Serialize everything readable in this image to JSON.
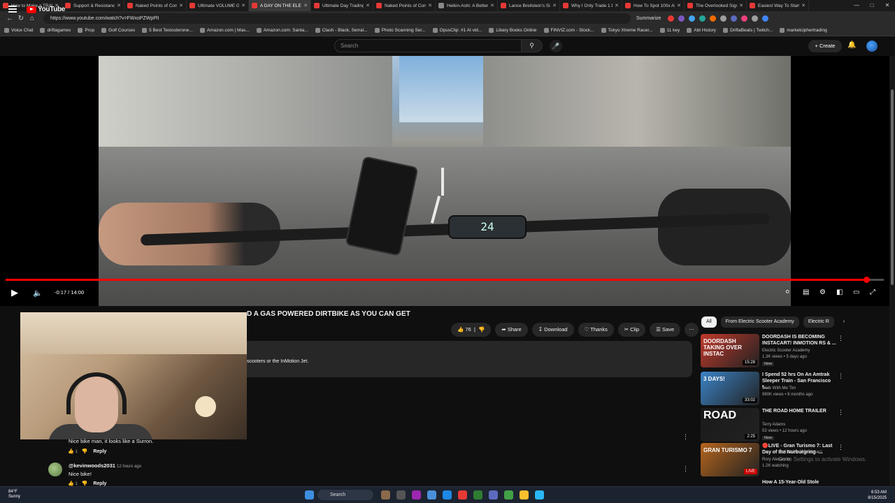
{
  "browser": {
    "tabs": [
      {
        "label": "How to Make a TRAD",
        "color": "#e53935"
      },
      {
        "label": "Support & Resistanc",
        "color": "#e53935"
      },
      {
        "label": "Naked Points of Cont",
        "color": "#e53935"
      },
      {
        "label": "Ultimate VOLUME Gu",
        "color": "#e53935"
      },
      {
        "label": "A DAY ON THE ELECT",
        "color": "#e53935",
        "active": true
      },
      {
        "label": "Ultimate Day Trading",
        "color": "#e53935"
      },
      {
        "label": "Naked Points of Cont",
        "color": "#e53935"
      },
      {
        "label": "Heikin-Ashi: A Better",
        "color": "#888888"
      },
      {
        "label": "Lance Breitstein's Sin",
        "color": "#e53935"
      },
      {
        "label": "Why I Only Trade 1 D",
        "color": "#e53935"
      },
      {
        "label": "How To Spot 100x Alt",
        "color": "#e53935"
      },
      {
        "label": "The Overlooked Sign",
        "color": "#e53935"
      },
      {
        "label": "Easiest Way To Start",
        "color": "#e53935"
      }
    ],
    "url": "https://www.youtube.com/watch?v=FWxoPZWpPlI",
    "summarize_label": "Summarize",
    "bookmarks": [
      "Voice Chat",
      "driftagames",
      "Prop",
      "Golf Courses",
      "5 Best Testosterone...",
      "Amazon.com | Mas...",
      "Amazon.com: Santa...",
      "Clash - Black, Serrat...",
      "Photo Scanning Ser...",
      "OpusClip: #1 AI vid...",
      "Libary Books Online",
      "FINVIZ.com - Stock...",
      "Tokyo Xtreme Racer...",
      "11 key",
      "Abt History",
      "DriftaBeats | Twitch...",
      "marketciphertrading"
    ]
  },
  "youtube": {
    "logo_text": "YouTube",
    "search_placeholder": "Search",
    "create_label": "+ Create"
  },
  "player": {
    "speedometer": "24",
    "timecode": "-0:17 / 14:00",
    "progress_fraction": 0.98
  },
  "video": {
    "title_visible": "D A GAS POWERED DIRTBIKE AS YOU CAN GET",
    "likes": "76",
    "share_label": "Share",
    "download_label": "Download",
    "thanks_label": "Thanks",
    "clip_label": "Clip",
    "save_label": "Save",
    "description_visible": "scooters or the InMotion Jet."
  },
  "comments": [
    {
      "author": "",
      "text": "Nice bike man, it looks like a Surron.",
      "likes": "1",
      "reply_label": "Reply"
    },
    {
      "author": "@kevinwoods2031",
      "time": "12 hours ago",
      "text": "Nice bike!",
      "likes": "1",
      "reply_label": "Reply"
    }
  ],
  "chips": [
    "All",
    "From Electric Scooter Academy",
    "Electric R"
  ],
  "recommendations": [
    {
      "title": "DOORDASH IS BECOMING INSTACART! INMOTION RS & ...",
      "channel": "Electric Scooter Academy",
      "views": "1.3K views • 5 days ago",
      "badge": "New",
      "duration": "15:28",
      "thumb_color": "#c0392b"
    },
    {
      "title": "I Spend 52 hrs On An Amtrak Sleeper Train - San Francisco t...",
      "channel": "Walk With Me Tim",
      "views": "980K views • 8 months ago",
      "badge": "",
      "duration": "33:02",
      "thumb_color": "#3b83c6"
    },
    {
      "title": "THE ROAD HOME TRAILER",
      "channel": "Terry Adams",
      "views": "53 views • 12 hours ago",
      "badge": "New",
      "duration": "2:25",
      "thumb_color": "#1a1a1a"
    },
    {
      "title": "🔴LIVE - Gran Turismo 7: Last Day of the Nurburgring -...",
      "channel": "Rory Alexander",
      "views": "1.2K watching",
      "badge": "",
      "duration": "LIVE",
      "thumb_color": "#b5651d"
    },
    {
      "title": "How A 15-Year-Old Stole",
      "channel": "",
      "views": "",
      "badge": "",
      "duration": "",
      "thumb_color": "#444444"
    }
  ],
  "thumb_texts": [
    "DOORDASH TAKING OVER INSTAC",
    "3 DAYS!",
    "ROAD",
    "GRAN TURISMO 7"
  ],
  "watermark": {
    "line1": "Activate Windows",
    "line2": "Go to Settings to activate Windows."
  },
  "taskbar": {
    "weather_temp": "84°F",
    "weather_text": "Sunny",
    "search_label": "Search",
    "time": "6:53 AM",
    "date": "8/15/2025"
  }
}
